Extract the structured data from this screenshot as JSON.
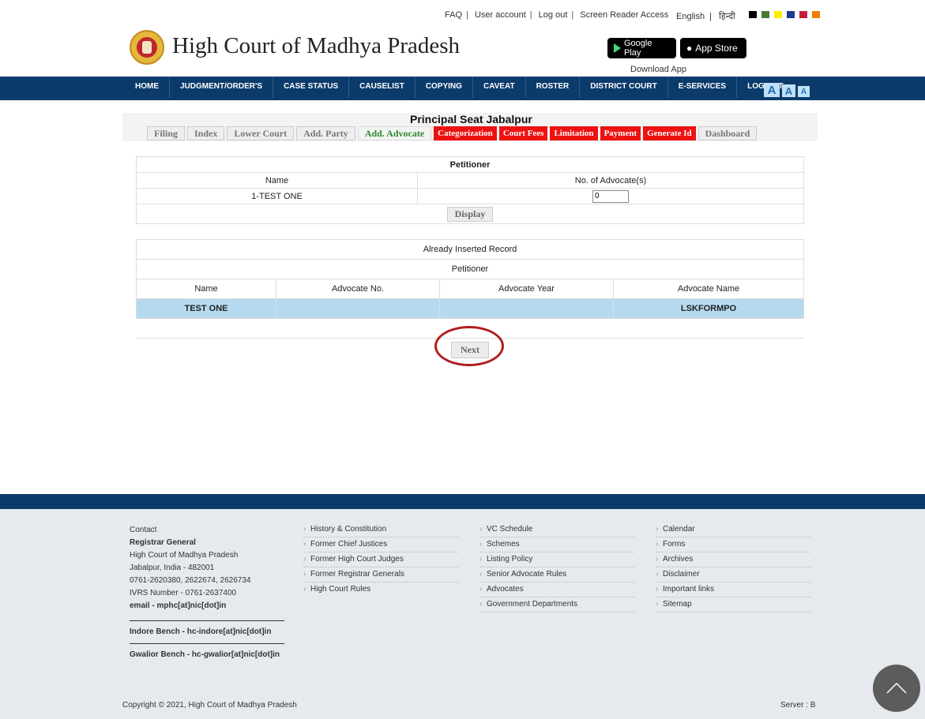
{
  "top_links": [
    "FAQ",
    "User account",
    "Log out",
    "Screen Reader Access"
  ],
  "lang": {
    "english": "English",
    "hindi": "हिन्दी"
  },
  "theme_swatches": [
    "#000000",
    "#4a7a3a",
    "#ffee00",
    "#1c3d8c",
    "#c41e3a",
    "#f27c00"
  ],
  "site": {
    "title": "High Court of Madhya Pradesh"
  },
  "apps": {
    "google_play": "Google Play",
    "app_store": "App Store",
    "download_label": "Download App"
  },
  "nav": [
    "HOME",
    "JUDGMENT/ORDER'S",
    "CASE STATUS",
    "CAUSELIST",
    "COPYING",
    "CAVEAT",
    "ROSTER",
    "DISTRICT COURT",
    "E-SERVICES",
    "LOG OUT"
  ],
  "font_size_buttons": [
    "A",
    "A",
    "A"
  ],
  "seat_title": "Principal Seat Jabalpur",
  "tabs": [
    {
      "label": "Filing",
      "style": "gray"
    },
    {
      "label": "Index",
      "style": "gray"
    },
    {
      "label": "Lower Court",
      "style": "gray"
    },
    {
      "label": "Add. Party",
      "style": "gray"
    },
    {
      "label": "Add. Advocate",
      "style": "green"
    },
    {
      "label": "Categorization",
      "style": "red"
    },
    {
      "label": "Court Fees",
      "style": "red"
    },
    {
      "label": "Limitation",
      "style": "red"
    },
    {
      "label": "Payment",
      "style": "red"
    },
    {
      "label": "Generate Id",
      "style": "red"
    },
    {
      "label": "Dashboard",
      "style": "gray"
    }
  ],
  "petitioner_table": {
    "title": "Petitioner",
    "col_name": "Name",
    "col_count": "No. of Advocate(s)",
    "row_name": "1-TEST ONE",
    "row_count": "0",
    "display_button": "Display"
  },
  "inserted_table": {
    "title": "Already Inserted Record",
    "subtitle": "Petitioner",
    "columns": [
      "Name",
      "Advocate No.",
      "Advocate Year",
      "Advocate Name"
    ],
    "rows": [
      [
        "TEST ONE",
        "",
        "",
        "LSKFORMPO"
      ]
    ]
  },
  "next_button": "Next",
  "footer": {
    "contact": {
      "heading": "Contact",
      "org": "Registrar General",
      "line1": "High Court of Madhya Pradesh",
      "line2": "Jabalpur, India - 482001",
      "phones": "0761-2620380, 2622674, 2626734",
      "ivrs": "IVRS Number - 0761-2637400",
      "email": "email - mphc[at]nic[dot]in",
      "indore": "Indore Bench - hc-indore[at]nic[dot]in",
      "gwalior": "Gwalior Bench - hc-gwalior[at]nic[dot]in"
    },
    "col1": [
      "History & Constitution",
      "Former Chief Justices",
      "Former High Court Judges",
      "Former Registrar Generals",
      "High Court Rules"
    ],
    "col2": [
      "VC Schedule",
      "Schemes",
      "Listing Policy",
      "Senior Advocate Rules",
      "Advocates",
      "Government Departments"
    ],
    "col3": [
      "Calendar",
      "Forms",
      "Archives",
      "Disclaimer",
      "Important links",
      "Sitemap"
    ],
    "copyright": "Copyright © 2021, High Court of Madhya Pradesh",
    "server": "Server : B"
  }
}
